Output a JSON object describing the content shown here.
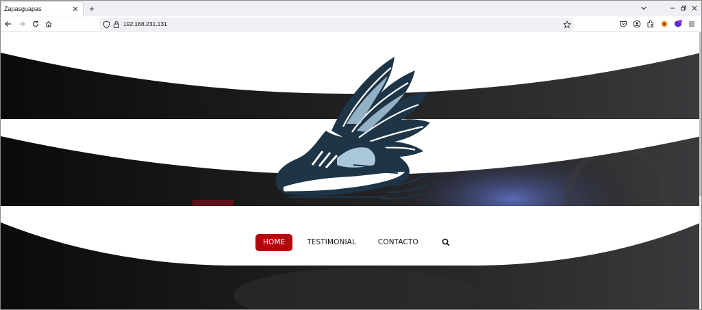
{
  "browser": {
    "tab_title": "Zapasguapas",
    "tab_close_glyph": "✕",
    "new_tab_glyph": "+",
    "url": "192.168.231.131",
    "window_controls": {
      "list_glyph": "⌄",
      "minimize_glyph": "—",
      "restore_glyph": "❐",
      "close_glyph": "✕"
    }
  },
  "site": {
    "logo_icon": "winged-shoe-logo",
    "nav": {
      "home": "HOME",
      "testimonial": "TESTIMONIAL",
      "contacto": "CONTACTO"
    },
    "accent_color": "#b5060d"
  }
}
